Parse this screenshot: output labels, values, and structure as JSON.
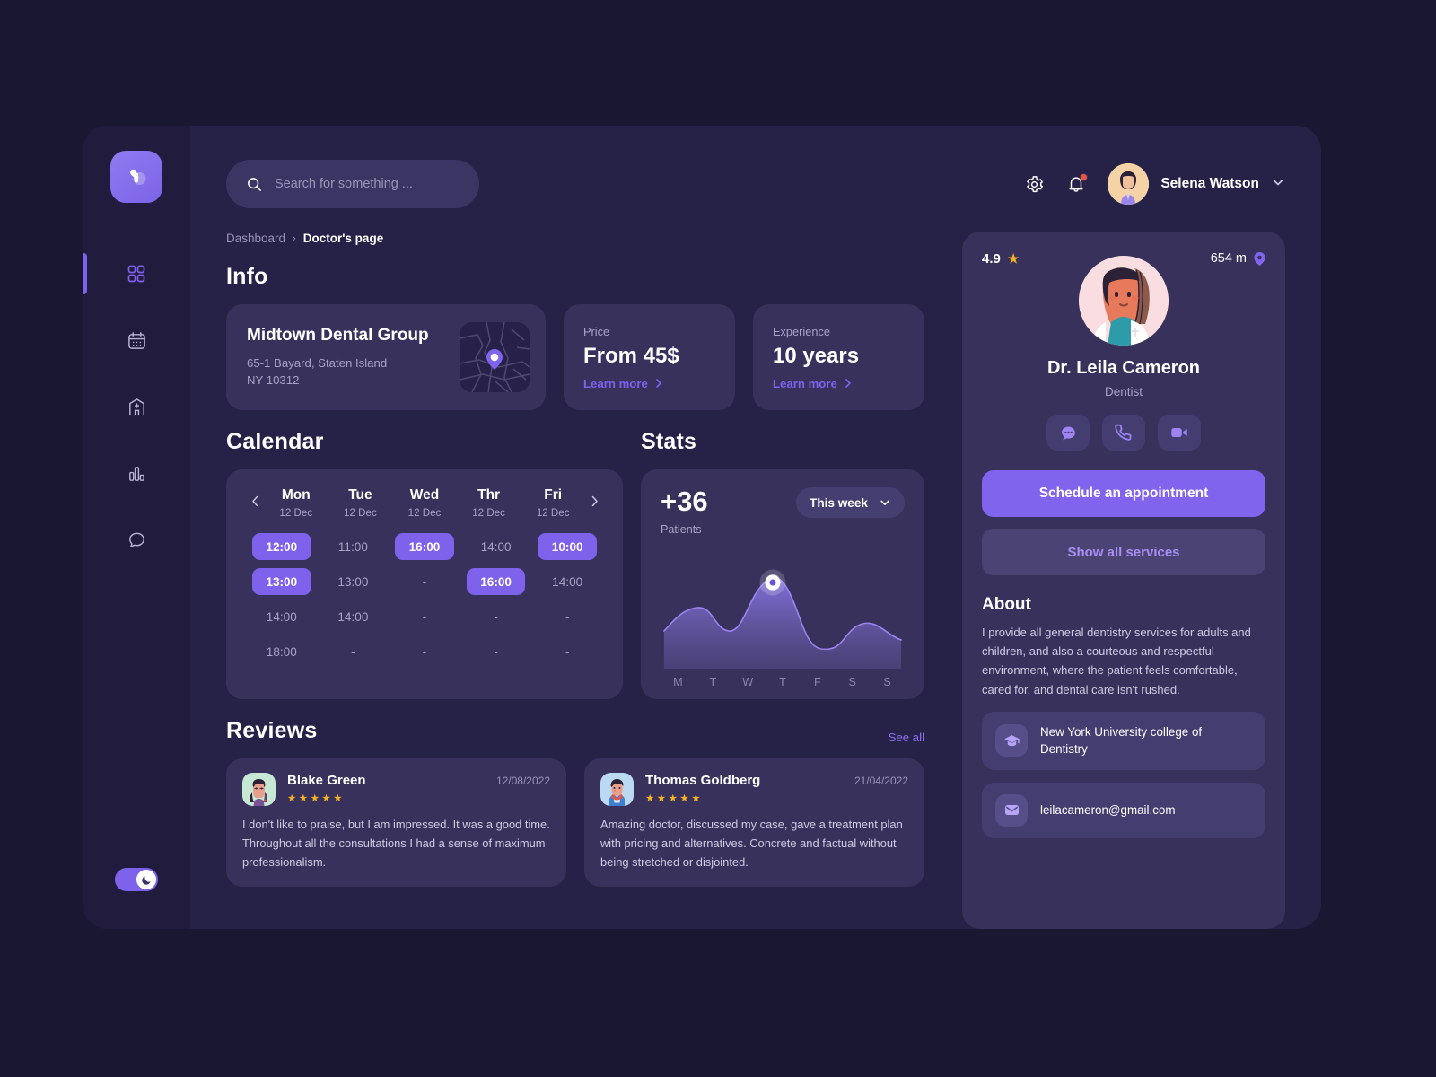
{
  "app": {
    "brand_icon": "medical-cross-heart-logo",
    "accent": "#7f62ec",
    "bg": "#1a1733",
    "panel": "#262146",
    "card": "#37315c",
    "star_color": "#f5b323"
  },
  "sidebar": {
    "items": [
      {
        "icon": "grid-dashboard-icon",
        "name": "dashboard",
        "active": true
      },
      {
        "icon": "calendar-icon",
        "name": "calendar",
        "active": false
      },
      {
        "icon": "hospital-icon",
        "name": "clinics",
        "active": false
      },
      {
        "icon": "bar-chart-icon",
        "name": "statistics",
        "active": false
      },
      {
        "icon": "chat-icon",
        "name": "messages",
        "active": false
      }
    ],
    "theme_toggle": {
      "icon": "moon-icon",
      "state": "dark",
      "on": true
    }
  },
  "header": {
    "search": {
      "placeholder": "Search for something ...",
      "value": "",
      "icon": "search-icon"
    },
    "settings_icon": "gear-icon",
    "notifications_icon": "bell-icon",
    "has_notification": true,
    "user": {
      "name": "Selena Watson",
      "avatar": "user-avatar",
      "chevron": "chevron-down-icon"
    }
  },
  "breadcrumb": {
    "root": "Dashboard",
    "separator": "›",
    "current": "Doctor's page"
  },
  "info": {
    "title": "Info",
    "clinic": {
      "name": "Midtown Dental Group",
      "address_line1": "65-1 Bayard, Staten Island",
      "address_line2": "NY 10312",
      "map_icon": "map-pin-icon"
    },
    "cards": [
      {
        "label": "Price",
        "value": "From 45$",
        "link": "Learn more",
        "link_icon": "chevron-right-icon"
      },
      {
        "label": "Experience",
        "value": "10 years",
        "link": "Learn more",
        "link_icon": "chevron-right-icon"
      }
    ]
  },
  "calendar": {
    "title": "Calendar",
    "prev_icon": "chevron-left-icon",
    "next_icon": "chevron-right-icon",
    "days": [
      {
        "name": "Mon",
        "date": "12 Dec"
      },
      {
        "name": "Tue",
        "date": "12 Dec"
      },
      {
        "name": "Wed",
        "date": "12 Dec"
      },
      {
        "name": "Thr",
        "date": "12 Dec"
      },
      {
        "name": "Fri",
        "date": "12 Dec"
      }
    ],
    "slots": [
      [
        {
          "t": "12:00",
          "sel": true
        },
        {
          "t": "11:00",
          "sel": false
        },
        {
          "t": "16:00",
          "sel": true
        },
        {
          "t": "14:00",
          "sel": false
        },
        {
          "t": "10:00",
          "sel": true
        }
      ],
      [
        {
          "t": "13:00",
          "sel": true
        },
        {
          "t": "13:00",
          "sel": false
        },
        {
          "t": "-",
          "sel": false
        },
        {
          "t": "16:00",
          "sel": true
        },
        {
          "t": "14:00",
          "sel": false
        }
      ],
      [
        {
          "t": "14:00",
          "sel": false
        },
        {
          "t": "14:00",
          "sel": false
        },
        {
          "t": "-",
          "sel": false
        },
        {
          "t": "-",
          "sel": false
        },
        {
          "t": "-",
          "sel": false
        }
      ],
      [
        {
          "t": "18:00",
          "sel": false
        },
        {
          "t": "-",
          "sel": false
        },
        {
          "t": "-",
          "sel": false
        },
        {
          "t": "-",
          "sel": false
        },
        {
          "t": "-",
          "sel": false
        }
      ]
    ]
  },
  "stats": {
    "title": "Stats",
    "count": "+36",
    "count_label": "Patients",
    "range_label": "This week",
    "range_icon": "chevron-down-icon"
  },
  "chart_data": {
    "type": "area",
    "title": "Patients",
    "categories": [
      "M",
      "T",
      "W",
      "T",
      "F",
      "S",
      "S"
    ],
    "values": [
      32,
      52,
      34,
      96,
      20,
      45,
      30
    ],
    "series": [
      {
        "name": "Patients",
        "values": [
          32,
          52,
          34,
          96,
          20,
          45,
          30
        ]
      }
    ],
    "highlight_index": 3,
    "highlight_label": "",
    "xlabel": "",
    "ylabel": "Patients",
    "ylim": [
      0,
      100
    ],
    "grid": false,
    "legend": "none",
    "line_color": "#9d84f2",
    "fill_color": "#6f5fae"
  },
  "reviews": {
    "title": "Reviews",
    "see_all": "See all",
    "items": [
      {
        "name": "Blake Green",
        "date": "12/08/2022",
        "stars": 5,
        "avatar": "reviewer-avatar-female",
        "text": "I don't like to praise, but I am impressed. It was a good time. Throughout all the consultations I had a sense of maximum professionalism."
      },
      {
        "name": "Thomas Goldberg",
        "date": "21/04/2022",
        "stars": 5,
        "avatar": "reviewer-avatar-male",
        "text": "Amazing doctor, discussed my case, gave a treatment plan with pricing and alternatives. Concrete and factual without being stretched or disjointed."
      }
    ]
  },
  "doctor": {
    "rating": "4.9",
    "rating_icon": "star-icon",
    "distance": "654 m",
    "distance_icon": "location-pin-icon",
    "photo": "doctor-avatar",
    "name": "Dr. Leila Cameron",
    "role": "Dentist",
    "contacts": [
      {
        "icon": "chat-bubble-icon",
        "name": "message"
      },
      {
        "icon": "phone-icon",
        "name": "call"
      },
      {
        "icon": "video-camera-icon",
        "name": "video-call"
      }
    ],
    "primary_button": "Schedule an appointment",
    "secondary_button": "Show all services",
    "about_title": "About",
    "about_text": "I provide all general dentistry services for adults and children, and also a courteous and respectful environment, where the patient feels comfortable, cared for, and dental care isn't rushed.",
    "details": [
      {
        "icon": "graduation-cap-icon",
        "text": "New York University college of Dentistry"
      },
      {
        "icon": "envelope-icon",
        "text": "leilacameron@gmail.com"
      }
    ]
  }
}
